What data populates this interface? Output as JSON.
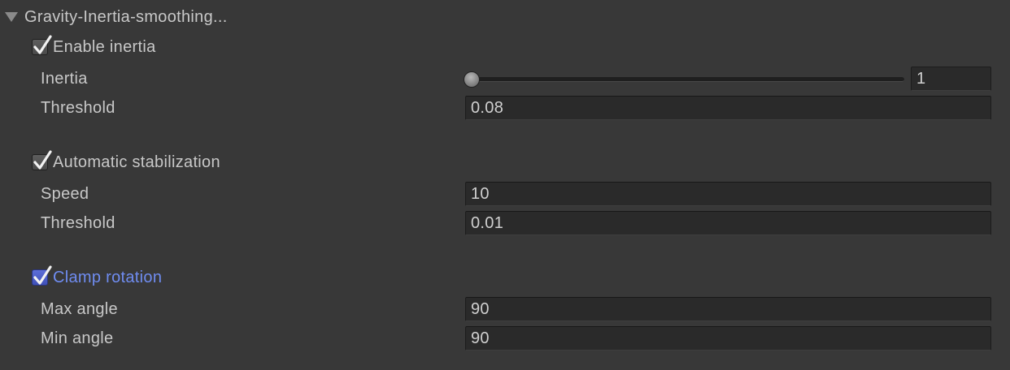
{
  "section": {
    "title": "Gravity-Inertia-smoothing..."
  },
  "inertia_group": {
    "toggle_label": "Enable inertia",
    "checked": true,
    "inertia_label": "Inertia",
    "inertia_value": "1",
    "inertia_slider_fraction": 0,
    "threshold_label": "Threshold",
    "threshold_value": "0.08"
  },
  "stabilization_group": {
    "toggle_label": "Automatic stabilization",
    "checked": true,
    "speed_label": "Speed",
    "speed_value": "10",
    "threshold_label": "Threshold",
    "threshold_value": "0.01"
  },
  "clamp_group": {
    "toggle_label": "Clamp rotation",
    "checked": true,
    "focused": true,
    "max_angle_label": "Max angle",
    "max_angle_value": "90",
    "min_angle_label": "Min angle",
    "min_angle_value": "90"
  },
  "colors": {
    "background": "#383838",
    "text": "#c8c8c8",
    "focus_accent": "#6f8cf0",
    "field_background": "#2a2a2a"
  },
  "icons": {
    "foldout": "triangle-down-icon",
    "check": "checkmark-icon"
  }
}
